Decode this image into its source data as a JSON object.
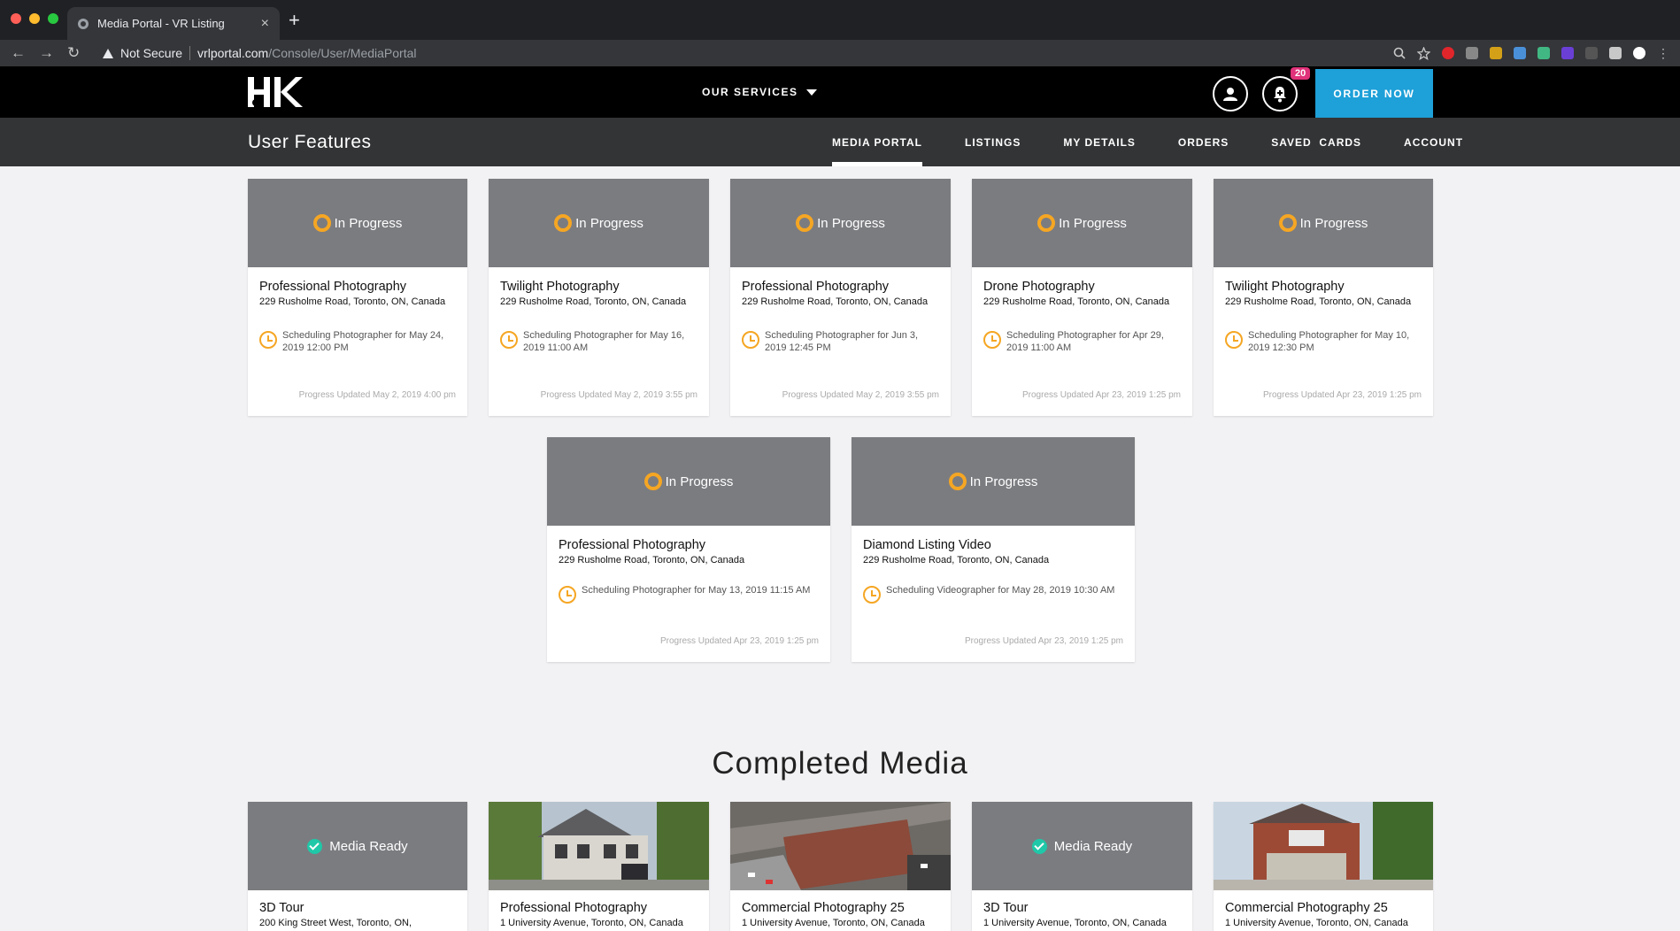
{
  "browser": {
    "tab_title": "Media Portal - VR Listing",
    "tab_close": "×",
    "new_tab": "+",
    "back": "←",
    "forward": "→",
    "reload": "↻",
    "security": "Not Secure",
    "url_host": "vrlportal.com",
    "url_path": "/Console/User/MediaPortal"
  },
  "header": {
    "services": "OUR SERVICES",
    "notification_count": "20",
    "order_now": "ORDER NOW"
  },
  "subnav": {
    "heading": "User Features",
    "links": [
      "MEDIA PORTAL",
      "LISTINGS",
      "MY DETAILS",
      "ORDERS",
      "SAVED  CARDS",
      "ACCOUNT"
    ],
    "active_index": 0
  },
  "in_progress": [
    {
      "status": "In Progress",
      "title": "Professional Photography",
      "address": "229 Rusholme Road, Toronto, ON, Canada",
      "schedule": "Scheduling Photographer for May 24, 2019 12:00 PM",
      "updated": "Progress Updated May 2, 2019 4:00 pm"
    },
    {
      "status": "In Progress",
      "title": "Twilight Photography",
      "address": "229 Rusholme Road, Toronto, ON, Canada",
      "schedule": "Scheduling Photographer for May 16, 2019 11:00 AM",
      "updated": "Progress Updated May 2, 2019 3:55 pm"
    },
    {
      "status": "In Progress",
      "title": "Professional Photography",
      "address": "229 Rusholme Road, Toronto, ON, Canada",
      "schedule": "Scheduling Photographer for Jun 3, 2019 12:45 PM",
      "updated": "Progress Updated May 2, 2019 3:55 pm"
    },
    {
      "status": "In Progress",
      "title": "Drone Photography",
      "address": "229 Rusholme Road, Toronto, ON, Canada",
      "schedule": "Scheduling Photographer for Apr 29, 2019 11:00 AM",
      "updated": "Progress Updated Apr 23, 2019 1:25 pm"
    },
    {
      "status": "In Progress",
      "title": "Twilight Photography",
      "address": "229 Rusholme Road, Toronto, ON, Canada",
      "schedule": "Scheduling Photographer for May 10, 2019 12:30 PM",
      "updated": "Progress Updated Apr 23, 2019 1:25 pm"
    },
    {
      "status": "In Progress",
      "title": "Professional Photography",
      "address": "229 Rusholme Road, Toronto, ON, Canada",
      "schedule": "Scheduling Photographer for May 13, 2019 11:15 AM",
      "updated": "Progress Updated Apr 23, 2019 1:25 pm"
    },
    {
      "status": "In Progress",
      "title": "Diamond Listing Video",
      "address": "229 Rusholme Road, Toronto, ON, Canada",
      "schedule": "Scheduling Videographer for May 28, 2019 10:30 AM",
      "updated": "Progress Updated Apr 23, 2019 1:25 pm"
    }
  ],
  "completed_title": "Completed Media",
  "completed": [
    {
      "status": "Media Ready",
      "title": "3D Tour",
      "address": "200 King Street West, Toronto, ON,"
    },
    {
      "status": "",
      "title": "Professional Photography",
      "address": "1 University Avenue, Toronto, ON, Canada"
    },
    {
      "status": "",
      "title": "Commercial Photography 25",
      "address": "1 University Avenue, Toronto, ON, Canada"
    },
    {
      "status": "Media Ready",
      "title": "3D Tour",
      "address": "1 University Avenue, Toronto, ON, Canada"
    },
    {
      "status": "",
      "title": "Commercial Photography 25",
      "address": "1 University Avenue, Toronto, ON, Canada"
    }
  ],
  "colors": {
    "accent": "#1ea0d8",
    "progress": "#f5a623",
    "ready": "#1fc8a8",
    "badge": "#e0327a",
    "card_head": "#7b7c80"
  }
}
